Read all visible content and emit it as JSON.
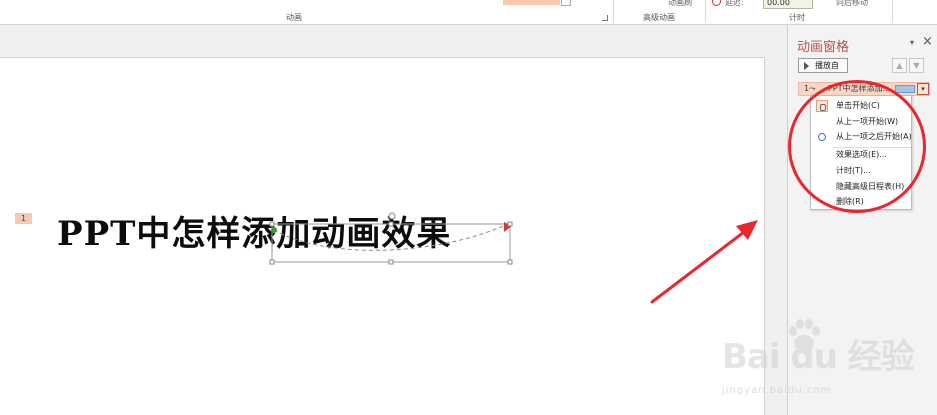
{
  "ribbon": {
    "group_animation": "动画",
    "group_advanced": "高级动画",
    "group_timing": "计时",
    "clip_anim_brush": "动画刷",
    "clip_delay_label": "延迟:",
    "clip_delay_value": "00.00",
    "clip_move_later": "向后移动"
  },
  "slide": {
    "anim_tag": "1",
    "title": "PPT中怎样添加动画效果"
  },
  "pane": {
    "title": "动画窗格",
    "dropdown_glyph": "▾",
    "close_glyph": "×",
    "play_label": "播放自",
    "move_up_glyph": "▲",
    "move_down_glyph": "▼",
    "item": {
      "number": "1",
      "marker": "⤳",
      "name": "PPT中怎样添加...",
      "dropdown_glyph": "▾"
    }
  },
  "context_menu": {
    "items": [
      "单击开始(C)",
      "从上一项开始(W)",
      "从上一项之后开始(A)",
      "效果选项(E)...",
      "计时(T)...",
      "隐藏高级日程表(H)",
      "删除(R)"
    ]
  },
  "watermark": {
    "logo": "Bai du 经验",
    "url": "jingyan.baidu.com"
  },
  "colors": {
    "accent": "#c0504d",
    "annotation_red": "#e8282f",
    "item_bg": "#fbd6c6"
  }
}
